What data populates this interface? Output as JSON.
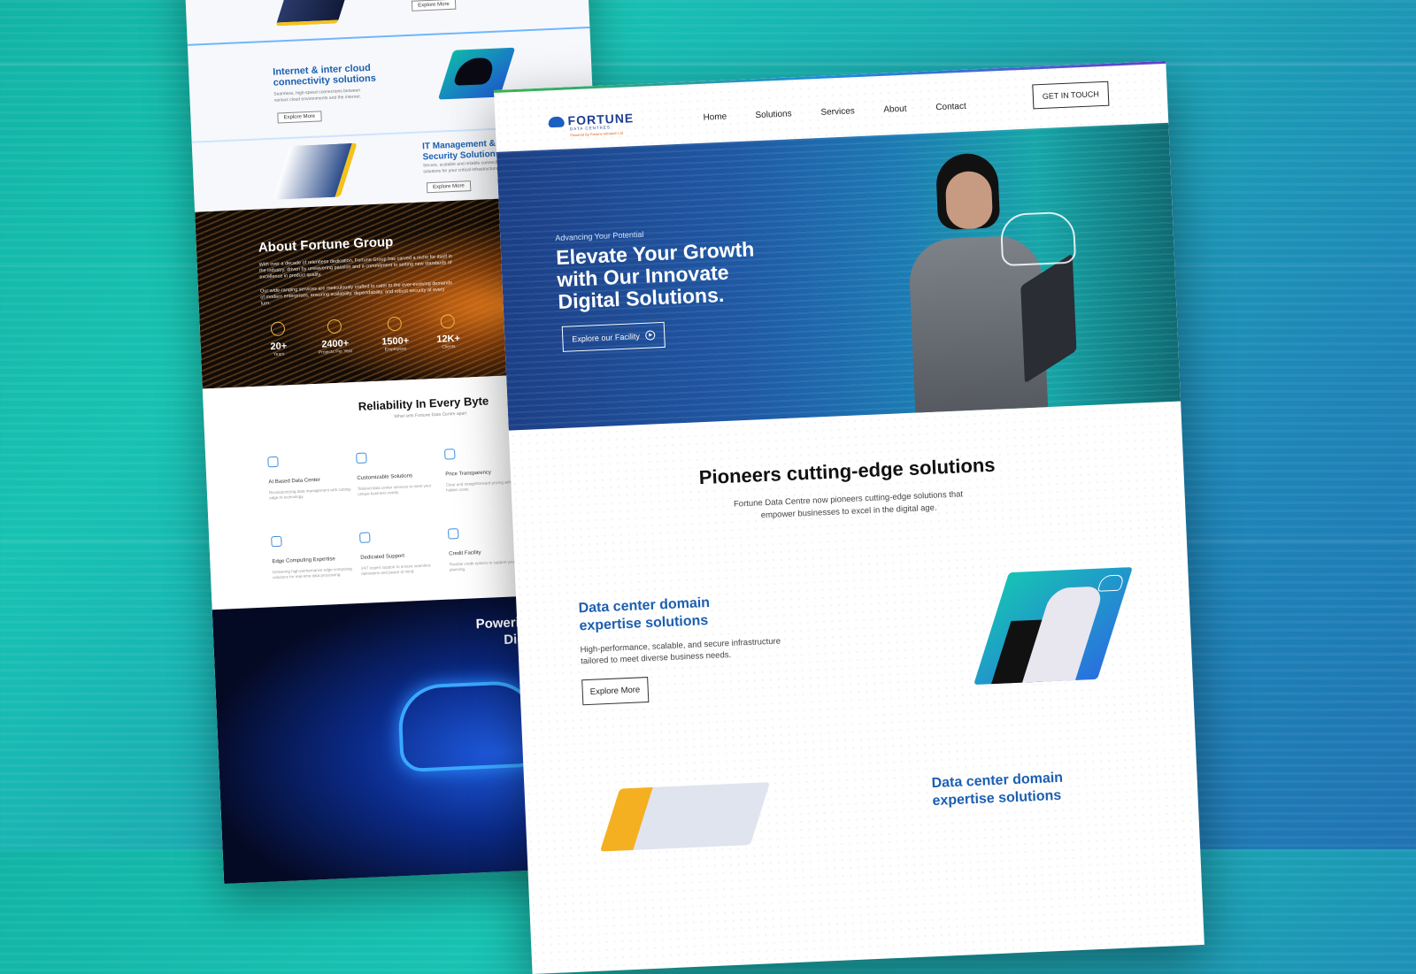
{
  "back_page": {
    "services": [
      {
        "title": "",
        "text": "",
        "button": "Explore More"
      },
      {
        "title": "Internet & inter cloud connectivity solutions",
        "text": "Seamless, high-speed connections between various cloud environments and the internet.",
        "button": "Explore More"
      },
      {
        "title": "IT Management & Cyb Security Solutions",
        "text": "Secure, scalable and reliable connection solutions for your critical infrastructure.",
        "button": "Explore More"
      }
    ],
    "about": {
      "title": "About Fortune Group",
      "para1": "With over a decade of relentless dedication, Fortune Group has carved a niche for itself in the industry, driven by unwavering passion and a commitment to setting new standards of excellence in product quality.",
      "para2": "Our wide-ranging services are meticulously crafted to cater to the ever-evolving demands of modern enterprises, ensuring scalability, dependability, and robust security at every turn.",
      "stats": [
        {
          "value": "20+",
          "label": "Years"
        },
        {
          "value": "2400+",
          "label": "Projects Per Year"
        },
        {
          "value": "1500+",
          "label": "Employees"
        },
        {
          "value": "12K+",
          "label": "Clients"
        }
      ]
    },
    "reliability": {
      "title": "Reliability In Every Byte",
      "subtitle": "What sets Fortune Data Centre apart",
      "features": [
        {
          "title": "AI Based Data Center",
          "text": "Revolutionizing data management with cutting-edge AI technology."
        },
        {
          "title": "Customizable Solutions",
          "text": "Tailored data center services to meet your unique business needs."
        },
        {
          "title": "Price Transparency",
          "text": "Clear and straightforward pricing with no hidden costs."
        },
        {
          "title": "Edge Computing Expertise",
          "text": "Delivering high-performance edge computing solutions for real-time data processing."
        },
        {
          "title": "Dedicated Support",
          "text": "24/7 expert support to ensure seamless operations and peace of mind."
        },
        {
          "title": "Credit Facility",
          "text": "Flexible credit options to support your financial planning."
        }
      ]
    },
    "powering": {
      "title_line1": "Powering Tomorr",
      "title_line2": "Digital World"
    }
  },
  "front_page": {
    "brand": {
      "name": "FORTUNE",
      "sub": "DATA CENTRES",
      "powered": "Powered By Fortune Infratech Ltd"
    },
    "nav": [
      "Home",
      "Solutions",
      "Services",
      "About",
      "Contact"
    ],
    "cta_button": "GET IN TOUCH",
    "hero": {
      "eyebrow": "Advancing Your Potential",
      "title": "Elevate Your Growth with Our Innovate Digital Solutions.",
      "button": "Explore our Facility"
    },
    "pioneers": {
      "title": "Pioneers cutting-edge solutions",
      "lead": "Fortune Data Centre now pioneers cutting-edge solutions that empower businesses to excel in the digital age."
    },
    "solution1": {
      "title": "Data center domain expertise solutions",
      "text": "High-performance, scalable, and secure infrastructure tailored to meet diverse business needs.",
      "button": "Explore More"
    },
    "solution2": {
      "title": "Data center domain expertise solutions"
    }
  },
  "colors": {
    "brand_blue": "#1c5fb0",
    "background_teal": "#17c2b2",
    "accent_orange": "#f5b640"
  }
}
